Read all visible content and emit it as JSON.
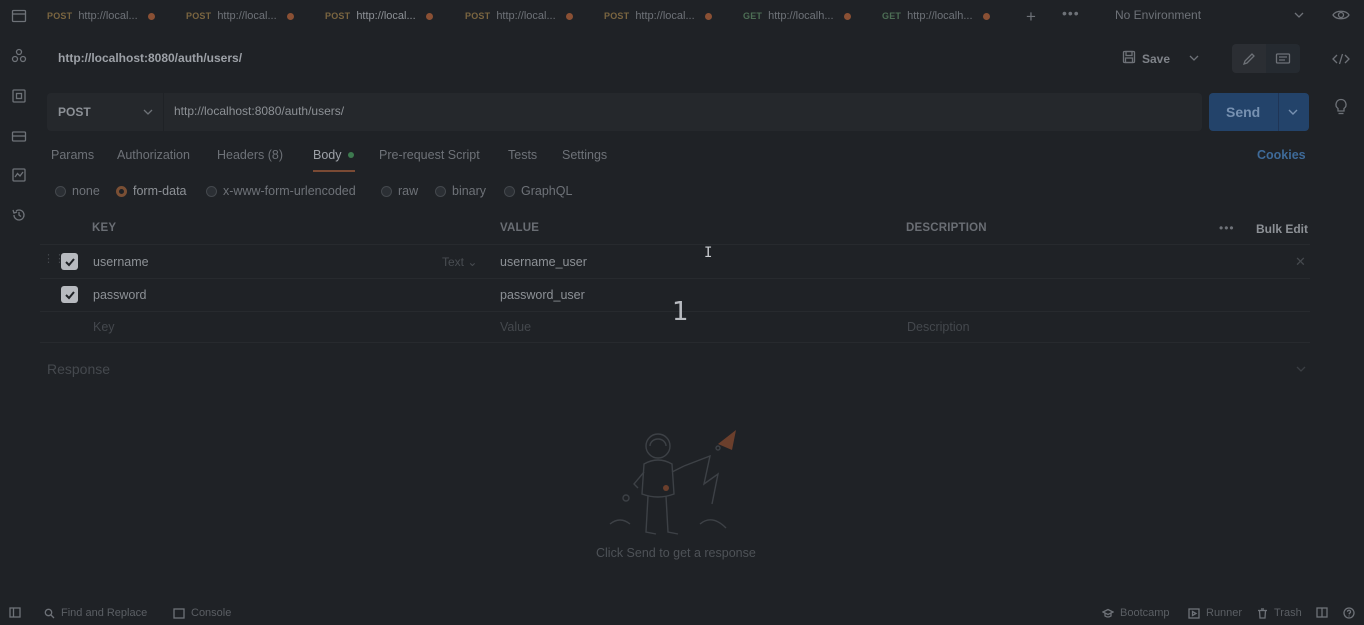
{
  "tabs": [
    {
      "method": "POST",
      "url": "http://local...",
      "method_class": "post",
      "active": false
    },
    {
      "method": "POST",
      "url": "http://local...",
      "method_class": "post",
      "active": false
    },
    {
      "method": "POST",
      "url": "http://local...",
      "method_class": "post",
      "active": true
    },
    {
      "method": "POST",
      "url": "http://local...",
      "method_class": "post",
      "active": false
    },
    {
      "method": "POST",
      "url": "http://local...",
      "method_class": "post",
      "active": false
    },
    {
      "method": "GET",
      "url": "http://localh...",
      "method_class": "get",
      "active": false
    },
    {
      "method": "GET",
      "url": "http://localh...",
      "method_class": "get",
      "active": false
    }
  ],
  "environment": "No Environment",
  "request": {
    "title": "http://localhost:8080/auth/users/",
    "method": "POST",
    "url": "http://localhost:8080/auth/users/",
    "save_label": "Save",
    "send_label": "Send"
  },
  "request_tabs": {
    "params": "Params",
    "authorization": "Authorization",
    "headers": "Headers",
    "headers_count": "(8)",
    "body": "Body",
    "prerequest": "Pre-request Script",
    "tests": "Tests",
    "settings": "Settings",
    "cookies": "Cookies"
  },
  "body_types": {
    "none": "none",
    "form_data": "form-data",
    "urlencoded": "x-www-form-urlencoded",
    "raw": "raw",
    "binary": "binary",
    "graphql": "GraphQL",
    "selected": "form-data"
  },
  "table": {
    "headers": {
      "key": "KEY",
      "value": "VALUE",
      "description": "DESCRIPTION",
      "bulk_edit": "Bulk Edit"
    },
    "rows": [
      {
        "key": "username",
        "value": "username_user",
        "type": "Text",
        "checked": true
      },
      {
        "key": "password",
        "value": "password_user",
        "checked": true
      }
    ],
    "placeholders": {
      "key": "Key",
      "value": "Value",
      "description": "Description"
    }
  },
  "overlay_text": "1",
  "response": {
    "title": "Response",
    "hint": "Click Send to get a response"
  },
  "footer": {
    "find_replace": "Find and Replace",
    "console": "Console",
    "bootcamp": "Bootcamp",
    "runner": "Runner",
    "trash": "Trash"
  },
  "colors": {
    "background": "#1f2226",
    "accent": "#23436a",
    "tab_active_underline": "#7a4a34",
    "unsaved_dot": "#8a5034"
  }
}
